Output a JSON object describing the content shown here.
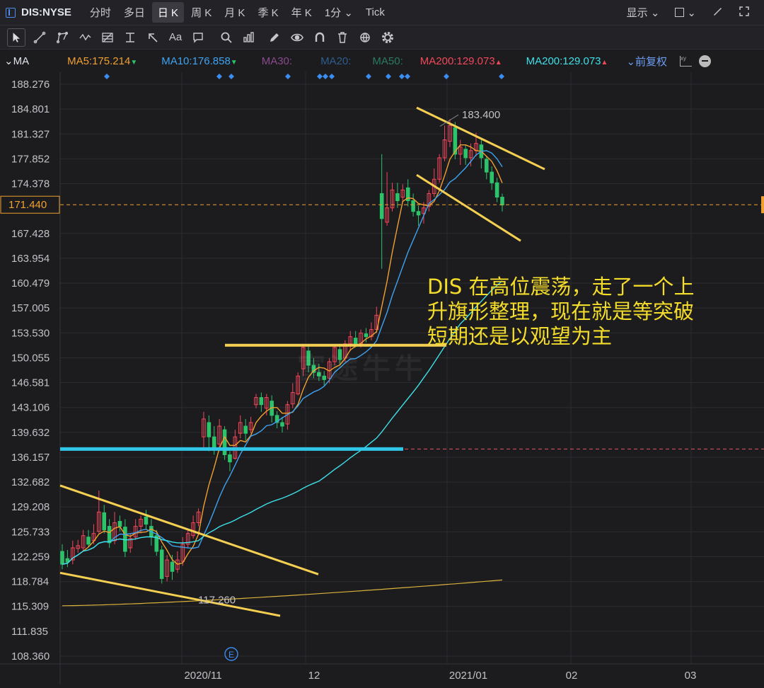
{
  "header": {
    "symbol": "DIS:NYSE",
    "periods": [
      "分时",
      "多日",
      "日 K",
      "周 K",
      "月 K",
      "季 K",
      "年 K"
    ],
    "active_period": "日 K",
    "minute_select": "1分",
    "tick": "Tick",
    "display_menu": "显示"
  },
  "toolbar": {
    "icons": [
      "cursor-icon",
      "line-tool-icon",
      "pattern-tool-icon",
      "wave-tool-icon",
      "fib-tool-icon",
      "level-tool-icon",
      "arrow-tool-icon",
      "text-tool-icon",
      "comment-tool-icon",
      "search-icon",
      "measure-icon",
      "pen-icon",
      "eye-icon",
      "magnet-icon",
      "trash-icon",
      "sync-icon",
      "gear-icon"
    ],
    "text_tool": "Aa"
  },
  "ma_bar": {
    "label": "MA",
    "items": [
      {
        "text": "MA5:175.214",
        "color": "#f0a030",
        "arrow": "▼",
        "arrow_color": "#2cc36b"
      },
      {
        "text": "MA10:176.858",
        "color": "#3ea3f0",
        "arrow": "▼",
        "arrow_color": "#2cc36b"
      },
      {
        "text": "MA30:",
        "color": "#8a4a8e",
        "arrow": "",
        "arrow_color": ""
      },
      {
        "text": "MA20:",
        "color": "#2d5d8e",
        "arrow": "",
        "arrow_color": ""
      },
      {
        "text": "MA50:",
        "color": "#2a7a5e",
        "arrow": "",
        "arrow_color": ""
      },
      {
        "text": "MA200:129.073",
        "color": "#f2475a",
        "arrow": "▲",
        "arrow_color": "#f2475a"
      },
      {
        "text": "MA200:129.073",
        "color": "#3ee0e8",
        "arrow": "▲",
        "arrow_color": "#f2475a"
      }
    ],
    "adjust": "前复权"
  },
  "chart_data": {
    "type": "candlestick",
    "y_ticks": [
      "188.276",
      "184.801",
      "181.327",
      "177.852",
      "174.378",
      "167.428",
      "163.954",
      "160.479",
      "157.005",
      "153.530",
      "150.055",
      "146.581",
      "143.106",
      "139.632",
      "136.157",
      "132.682",
      "129.208",
      "125.733",
      "122.259",
      "118.784",
      "115.309",
      "111.835",
      "108.360"
    ],
    "ylim": [
      108.36,
      188.276
    ],
    "x_ticks": [
      "2020/11",
      "12",
      "2021/01",
      "02",
      "03"
    ],
    "current_price": "171.440",
    "high_label": "183.400",
    "low_label": "117.260",
    "earnings_marker": "E",
    "candles_open_close_high_low": [
      [
        123.0,
        121.2,
        124.0,
        120.5
      ],
      [
        122.0,
        121.5,
        123.2,
        120.8
      ],
      [
        121.8,
        123.5,
        124.5,
        121.2
      ],
      [
        123.4,
        123.8,
        124.6,
        122.8
      ],
      [
        123.5,
        125.2,
        126.0,
        123.0
      ],
      [
        125.0,
        124.0,
        126.0,
        123.6
      ],
      [
        124.5,
        125.5,
        126.8,
        124.0
      ],
      [
        125.8,
        128.5,
        131.5,
        125.5
      ],
      [
        128.4,
        126.0,
        129.5,
        125.5
      ],
      [
        126.5,
        124.2,
        127.5,
        123.5
      ],
      [
        124.5,
        127.0,
        128.5,
        124.0
      ],
      [
        127.2,
        126.5,
        128.0,
        125.8
      ],
      [
        126.4,
        123.0,
        127.5,
        122.2
      ],
      [
        123.5,
        124.8,
        125.5,
        122.8
      ],
      [
        125.0,
        126.5,
        127.5,
        124.6
      ],
      [
        126.5,
        127.5,
        128.0,
        125.5
      ],
      [
        127.8,
        126.8,
        128.8,
        126.0
      ],
      [
        126.5,
        125.0,
        127.5,
        123.8
      ],
      [
        125.2,
        123.0,
        126.0,
        122.4
      ],
      [
        123.2,
        119.2,
        123.8,
        118.5
      ],
      [
        119.5,
        121.8,
        122.5,
        118.8
      ],
      [
        121.5,
        120.2,
        122.5,
        119.0
      ],
      [
        120.5,
        121.8,
        123.0,
        120.0
      ],
      [
        121.6,
        124.0,
        125.0,
        121.0
      ],
      [
        124.0,
        125.5,
        126.0,
        123.5
      ],
      [
        125.2,
        127.0,
        128.0,
        124.8
      ],
      [
        127.0,
        128.5,
        129.0,
        126.5
      ],
      [
        139.0,
        141.5,
        142.5,
        137.5
      ],
      [
        141.0,
        139.0,
        142.0,
        137.0
      ],
      [
        139.0,
        137.5,
        140.5,
        136.5
      ],
      [
        138.0,
        140.5,
        141.5,
        137.0
      ],
      [
        140.0,
        136.5,
        140.5,
        135.8
      ],
      [
        136.5,
        135.5,
        137.0,
        134.2
      ],
      [
        136.0,
        139.0,
        140.0,
        135.8
      ],
      [
        139.5,
        141.0,
        142.0,
        138.8
      ],
      [
        140.5,
        139.5,
        141.5,
        138.5
      ],
      [
        140.0,
        141.0,
        141.8,
        139.5
      ],
      [
        143.5,
        144.5,
        145.0,
        143.0
      ],
      [
        144.5,
        143.5,
        145.2,
        142.5
      ],
      [
        143.0,
        144.5,
        145.0,
        142.0
      ],
      [
        144.0,
        142.0,
        144.8,
        141.0
      ],
      [
        142.0,
        141.0,
        142.6,
        140.2
      ],
      [
        141.0,
        140.5,
        141.8,
        139.6
      ],
      [
        140.8,
        143.5,
        144.0,
        140.0
      ],
      [
        143.6,
        145.2,
        146.5,
        143.0
      ],
      [
        145.0,
        147.5,
        148.0,
        144.8
      ],
      [
        148.5,
        151.5,
        152.0,
        147.5
      ],
      [
        151.0,
        149.0,
        151.8,
        148.0
      ],
      [
        149.0,
        148.0,
        150.0,
        147.2
      ],
      [
        148.0,
        147.5,
        149.2,
        146.8
      ],
      [
        147.5,
        147.0,
        148.2,
        146.2
      ],
      [
        147.2,
        149.5,
        150.0,
        146.5
      ],
      [
        149.5,
        151.5,
        152.0,
        149.0
      ],
      [
        151.2,
        149.8,
        152.0,
        149.0
      ],
      [
        150.0,
        152.0,
        152.5,
        149.5
      ],
      [
        152.0,
        153.0,
        153.8,
        151.0
      ],
      [
        152.8,
        152.0,
        153.8,
        151.5
      ],
      [
        152.0,
        153.5,
        154.0,
        151.5
      ],
      [
        153.4,
        153.0,
        154.2,
        152.2
      ],
      [
        153.0,
        154.0,
        155.0,
        152.5
      ],
      [
        154.0,
        156.0,
        157.2,
        153.5
      ],
      [
        173.0,
        169.5,
        178.5,
        162.5
      ],
      [
        169.0,
        171.0,
        176.0,
        168.5
      ],
      [
        171.0,
        173.5,
        174.5,
        170.5
      ],
      [
        173.0,
        172.0,
        174.5,
        171.0
      ],
      [
        172.5,
        173.5,
        174.3,
        171.8
      ],
      [
        173.8,
        172.0,
        175.0,
        171.2
      ],
      [
        172.0,
        170.5,
        173.0,
        169.8
      ],
      [
        170.5,
        170.0,
        171.3,
        168.5
      ],
      [
        170.2,
        171.0,
        171.8,
        168.8
      ],
      [
        171.2,
        173.0,
        173.5,
        170.5
      ],
      [
        173.0,
        175.0,
        176.5,
        172.5
      ],
      [
        175.0,
        178.0,
        178.5,
        174.5
      ],
      [
        178.0,
        180.5,
        182.5,
        177.5
      ],
      [
        180.3,
        182.5,
        183.4,
        179.5
      ],
      [
        182.2,
        178.5,
        183.0,
        177.8
      ],
      [
        178.5,
        179.5,
        180.5,
        177.0
      ],
      [
        179.2,
        178.0,
        179.8,
        177.0
      ],
      [
        178.0,
        179.0,
        180.0,
        176.8
      ],
      [
        179.0,
        180.0,
        181.5,
        178.2
      ],
      [
        179.8,
        178.0,
        180.5,
        176.5
      ],
      [
        177.8,
        176.0,
        178.2,
        175.0
      ],
      [
        176.0,
        174.5,
        176.8,
        173.5
      ],
      [
        174.5,
        172.5,
        175.2,
        171.8
      ],
      [
        172.5,
        171.4,
        173.0,
        170.5
      ]
    ],
    "candle_count": 84
  },
  "annotation": {
    "text": "DIS 在高位震荡，走了一个上\n升旗形整理，现在就是等突破\n短期还是以观望为主"
  },
  "watermark": "富途牛牛"
}
